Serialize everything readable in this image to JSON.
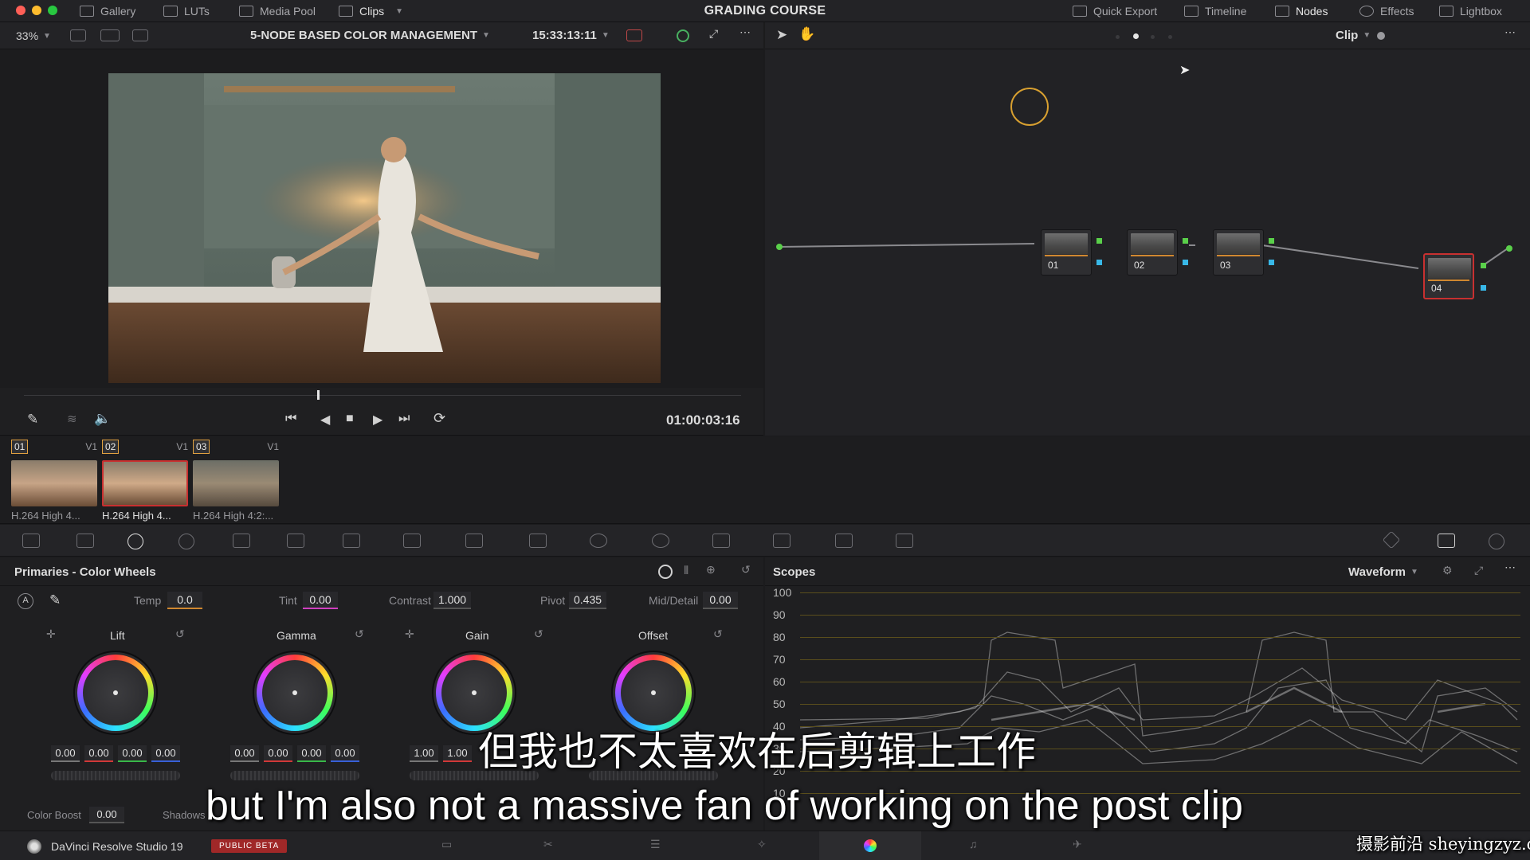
{
  "topbar": {
    "title": "GRADING COURSE",
    "left_items": [
      {
        "label": "Gallery",
        "icon": "gallery-icon"
      },
      {
        "label": "LUTs",
        "icon": "luts-icon"
      },
      {
        "label": "Media Pool",
        "icon": "media-pool-icon"
      },
      {
        "label": "Clips",
        "icon": "clips-icon"
      }
    ],
    "right_items": [
      {
        "label": "Quick Export",
        "icon": "export-icon"
      },
      {
        "label": "Timeline",
        "icon": "timeline-icon"
      },
      {
        "label": "Nodes",
        "icon": "nodes-icon"
      },
      {
        "label": "Effects",
        "icon": "effects-icon"
      },
      {
        "label": "Lightbox",
        "icon": "lightbox-icon"
      }
    ]
  },
  "viewer": {
    "zoom": "33%",
    "timeline_name": "5-NODE BASED COLOR MANAGEMENT",
    "source_timecode": "15:33:13:11",
    "playhead_timecode": "01:00:03:16"
  },
  "node_editor": {
    "mode": "Clip",
    "nodes": [
      "01",
      "02",
      "03",
      "04"
    ]
  },
  "clips": [
    {
      "number": "01",
      "track": "V1",
      "name": "H.264 High 4..."
    },
    {
      "number": "02",
      "track": "V1",
      "name": "H.264 High 4..."
    },
    {
      "number": "03",
      "track": "V1",
      "name": "H.264 High 4:2:..."
    }
  ],
  "primaries": {
    "title": "Primaries - Color Wheels",
    "params": {
      "temp_label": "Temp",
      "temp": "0.0",
      "tint_label": "Tint",
      "tint": "0.00",
      "contrast_label": "Contrast",
      "contrast": "1.000",
      "pivot_label": "Pivot",
      "pivot": "0.435",
      "middetail_label": "Mid/Detail",
      "middetail": "0.00"
    },
    "wheels": [
      {
        "name": "Lift",
        "values": [
          "0.00",
          "0.00",
          "0.00",
          "0.00"
        ]
      },
      {
        "name": "Gamma",
        "values": [
          "0.00",
          "0.00",
          "0.00",
          "0.00"
        ]
      },
      {
        "name": "Gain",
        "values": [
          "1.00",
          "1.00"
        ]
      },
      {
        "name": "Offset",
        "values": []
      }
    ],
    "color_boost_label": "Color Boost",
    "color_boost": "0.00",
    "shadows_label": "Shadows"
  },
  "scopes": {
    "title": "Scopes",
    "mode": "Waveform",
    "ticks": [
      "100",
      "90",
      "80",
      "70",
      "60",
      "50",
      "40",
      "30",
      "20",
      "10"
    ]
  },
  "bottombar": {
    "app_name": "DaVinci Resolve Studio 19",
    "badge": "PUBLIC BETA"
  },
  "subtitles": {
    "chinese": "但我也不太喜欢在后剪辑上工作",
    "english": "but I'm also not a massive fan of working on the post clip",
    "watermark": "摄影前沿 sheyingzyz.com"
  },
  "colors": {
    "accent_orange": "#d08830",
    "node_selected": "#c83030",
    "badge_red": "#a02828"
  }
}
